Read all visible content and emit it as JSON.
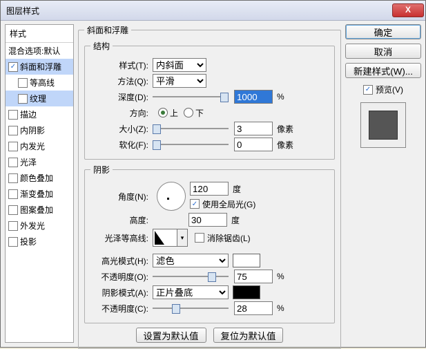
{
  "window": {
    "title": "图层样式"
  },
  "close_btn": "X",
  "styles": {
    "header": "样式",
    "blend_default": "混合选项:默认",
    "bevel_emboss": "斜面和浮雕",
    "contour": "等高线",
    "texture": "纹理",
    "stroke": "描边",
    "inner_shadow": "内阴影",
    "inner_glow": "内发光",
    "satin": "光泽",
    "color_overlay": "颜色叠加",
    "gradient_overlay": "渐变叠加",
    "pattern_overlay": "图案叠加",
    "outer_glow": "外发光",
    "drop_shadow": "投影"
  },
  "main": {
    "title": "斜面和浮雕",
    "structure": {
      "legend": "结构",
      "style_label": "样式(T):",
      "style_value": "内斜面",
      "method_label": "方法(Q):",
      "method_value": "平滑",
      "depth_label": "深度(D):",
      "depth_value": "1000",
      "depth_unit": "%",
      "direction_label": "方向:",
      "direction_up": "上",
      "direction_down": "下",
      "size_label": "大小(Z):",
      "size_value": "3",
      "size_unit": "像素",
      "soften_label": "软化(F):",
      "soften_value": "0",
      "soften_unit": "像素"
    },
    "shading": {
      "legend": "阴影",
      "angle_label": "角度(N):",
      "angle_value": "120",
      "angle_unit": "度",
      "global_light": "使用全局光(G)",
      "altitude_label": "高度:",
      "altitude_value": "30",
      "altitude_unit": "度",
      "gloss_label": "光泽等高线:",
      "antialias": "消除锯齿(L)",
      "highlight_mode_label": "高光模式(H):",
      "highlight_mode_value": "滤色",
      "highlight_opacity_label": "不透明度(O):",
      "highlight_opacity_value": "75",
      "highlight_opacity_unit": "%",
      "shadow_mode_label": "阴影模式(A):",
      "shadow_mode_value": "正片叠底",
      "shadow_opacity_label": "不透明度(C):",
      "shadow_opacity_value": "28",
      "shadow_opacity_unit": "%"
    },
    "set_default": "设置为默认值",
    "reset_default": "复位为默认值"
  },
  "right": {
    "ok": "确定",
    "cancel": "取消",
    "new_style": "新建样式(W)...",
    "preview": "预览(V)"
  }
}
